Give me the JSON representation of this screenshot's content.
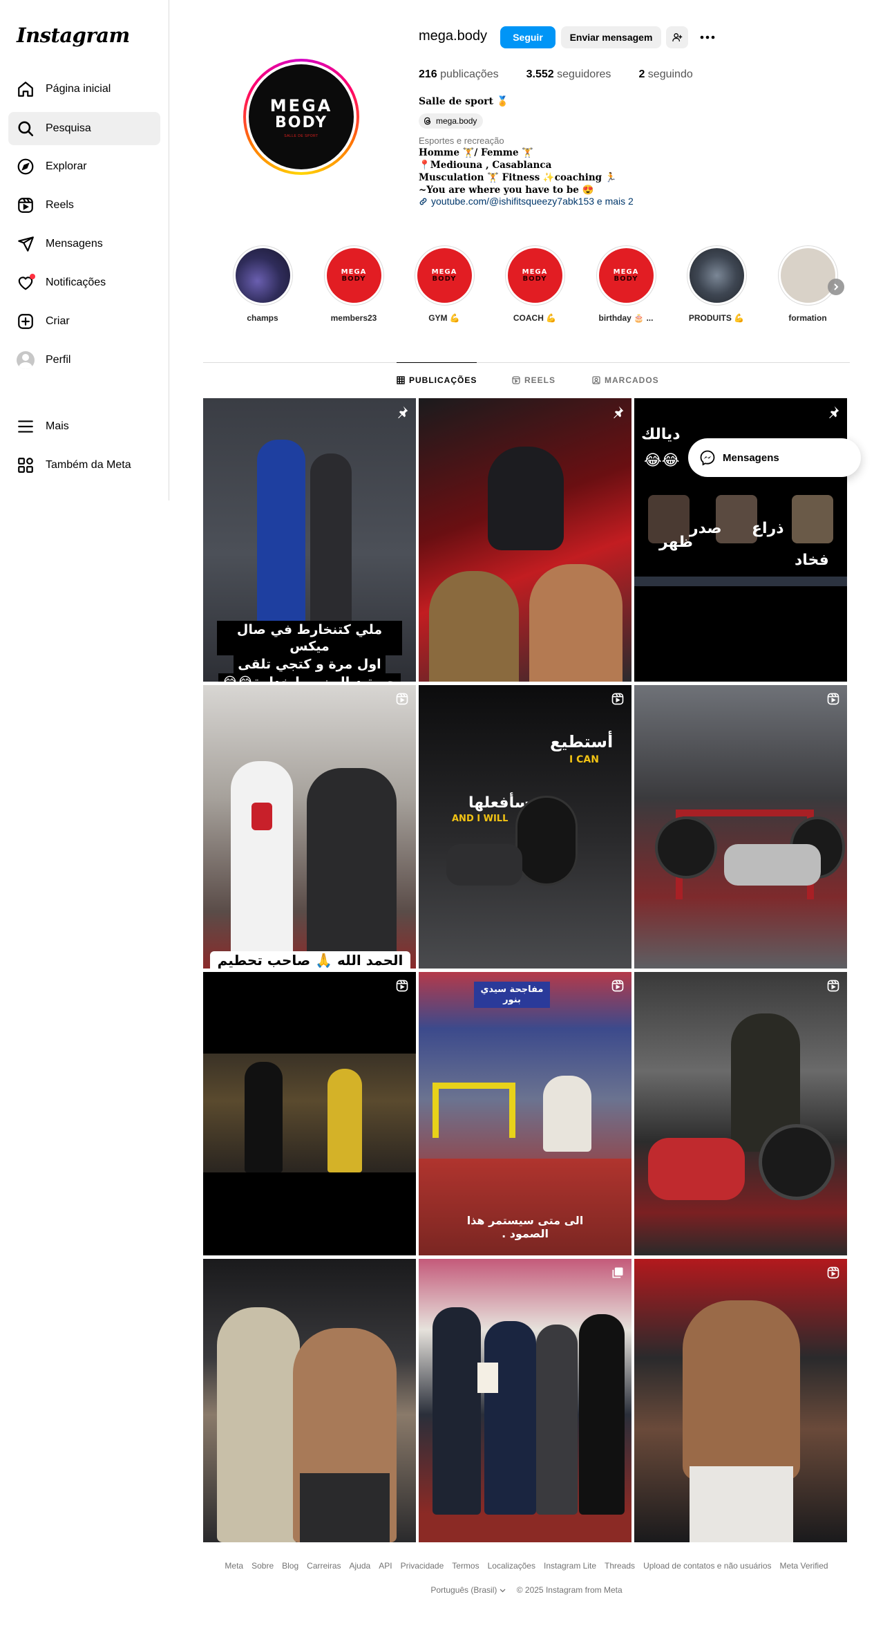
{
  "app": {
    "logo": "Instagram"
  },
  "sidebar": {
    "items": [
      {
        "label": "Página inicial",
        "icon": "home-icon"
      },
      {
        "label": "Pesquisa",
        "icon": "search-icon",
        "active": true
      },
      {
        "label": "Explorar",
        "icon": "compass-icon"
      },
      {
        "label": "Reels",
        "icon": "reels-icon"
      },
      {
        "label": "Mensagens",
        "icon": "send-icon"
      },
      {
        "label": "Notificações",
        "icon": "heart-icon",
        "badge": true
      },
      {
        "label": "Criar",
        "icon": "plus-square-icon"
      },
      {
        "label": "Perfil",
        "icon": "avatar"
      }
    ],
    "more": "Mais",
    "meta": "Também da Meta"
  },
  "profile": {
    "username": "mega.body",
    "follow_label": "Seguir",
    "message_label": "Enviar mensagem",
    "avatar_text": {
      "line1": "MEGA",
      "line2": "BODY",
      "line3": "SALLE DE SPORT"
    },
    "stats": {
      "posts_count": "216",
      "posts_label": "publicações",
      "followers_count": "3.552",
      "followers_label": "seguidores",
      "following_count": "2",
      "following_label": "seguindo"
    },
    "bio_name": "Salle de sport 🏅",
    "threads_handle": "mega.body",
    "category": "Esportes e recreação",
    "bio_lines": [
      "Homme 🏋️/ Femme 🏋️",
      "📍Mediouna , Casablanca",
      "Musculation 🏋️ Fitness ✨coaching 🏃",
      "~You are where you have to be 😍"
    ],
    "link_text": "youtube.com/@ishifitsqueezy7abk153 e mais 2"
  },
  "highlights": [
    {
      "label": "champs"
    },
    {
      "label": "members23"
    },
    {
      "label": "GYM 💪"
    },
    {
      "label": "COACH 💪"
    },
    {
      "label": "birthday 🎂 ..."
    },
    {
      "label": "PRODUITS 💪"
    },
    {
      "label": "formation"
    }
  ],
  "highlight_logo": {
    "l1": "MEGA",
    "l2": "BODY"
  },
  "tabs": [
    {
      "label": "PUBLICAÇÕES",
      "active": true
    },
    {
      "label": "REELS"
    },
    {
      "label": "MARCADOS"
    }
  ],
  "posts": {
    "p1_caption": [
      "ملي كتنخارط في صال ميكس",
      "اول مرة و كتجي تلقى",
      "حصة ديال زومبا خدامة😂😂"
    ],
    "p3_caption_top": "ديالك",
    "p3_emojis": "😂😂",
    "p3_labels": [
      "ذراع",
      "صدر",
      "ظهر",
      "فخاد"
    ],
    "p4_caption": "الحمد الله 🙏 صاحب تحطيم الرقم",
    "p5_caption": [
      "أستطيع",
      "I CAN",
      "وسأفعلها",
      "AND I WILL"
    ],
    "p8_caption": "الى متى سيستمر هذا الصمود .",
    "p8_banner": "مفاجحة سيدي بنور"
  },
  "messages_pill": "Mensagens",
  "footer": {
    "links": [
      "Meta",
      "Sobre",
      "Blog",
      "Carreiras",
      "Ajuda",
      "API",
      "Privacidade",
      "Termos",
      "Localizações",
      "Instagram Lite",
      "Threads",
      "Upload de contatos e não usuários",
      "Meta Verified"
    ],
    "language": "Português (Brasil)",
    "copyright": "© 2025 Instagram from Meta"
  }
}
